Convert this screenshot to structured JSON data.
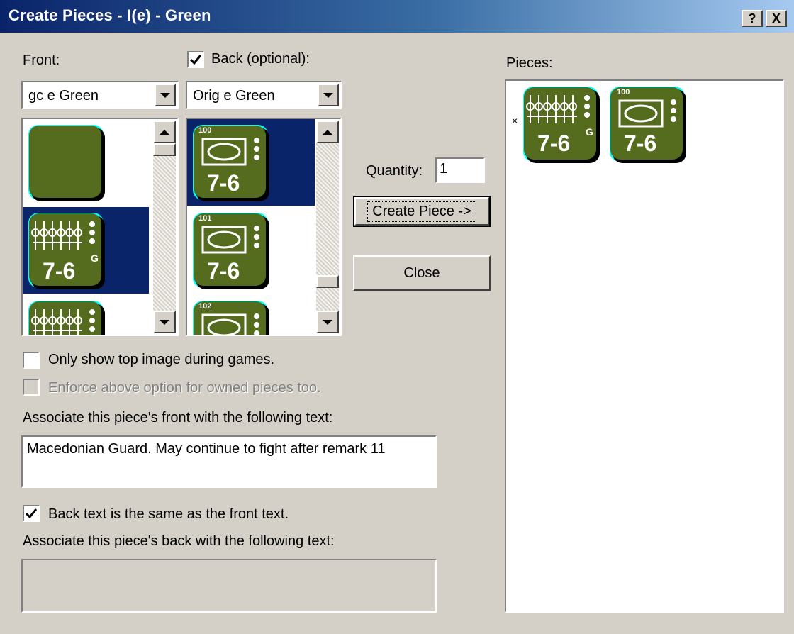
{
  "window": {
    "title": "Create Pieces - I(e) - Green",
    "help_button": "?",
    "close_button": "X"
  },
  "front": {
    "label": "Front:",
    "combo_value": "gc e Green"
  },
  "back": {
    "label": "Back (optional):",
    "checked": true,
    "combo_value": "Orig e Green"
  },
  "front_list": [
    {
      "kind": "blank",
      "selected": false
    },
    {
      "kind": "phalanx",
      "value": "7-6",
      "super": "G",
      "selected": true
    },
    {
      "kind": "phalanx",
      "value": "",
      "super": "",
      "selected": false
    }
  ],
  "back_list": [
    {
      "kind": "oval",
      "id": "100",
      "value": "7-6",
      "selected": true
    },
    {
      "kind": "oval",
      "id": "101",
      "value": "7-6",
      "selected": false
    },
    {
      "kind": "oval",
      "id": "102",
      "value": "",
      "selected": false
    }
  ],
  "quantity": {
    "label": "Quantity:",
    "value": "1"
  },
  "buttons": {
    "create_piece": "Create Piece ->",
    "close": "Close"
  },
  "pieces": {
    "label": "Pieces:",
    "marker": "×",
    "items": [
      {
        "kind": "phalanx",
        "value": "7-6",
        "super": "G"
      },
      {
        "kind": "oval",
        "id": "100",
        "value": "7-6"
      }
    ]
  },
  "options": {
    "only_top_image": "Only show top image during games.",
    "enforce_owned": "Enforce above option for owned pieces too."
  },
  "front_text": {
    "label": "Associate this piece's front with the following text:",
    "value": "Macedonian Guard. May continue to fight after remark 11"
  },
  "back_text": {
    "same_label": "Back text is the same as the front text.",
    "label": "Associate this piece's back with the following text:",
    "value": ""
  },
  "colors": {
    "counter_green": "#556b1d",
    "selection": "#0a246a",
    "dialog_bg": "#d4d0c8"
  }
}
